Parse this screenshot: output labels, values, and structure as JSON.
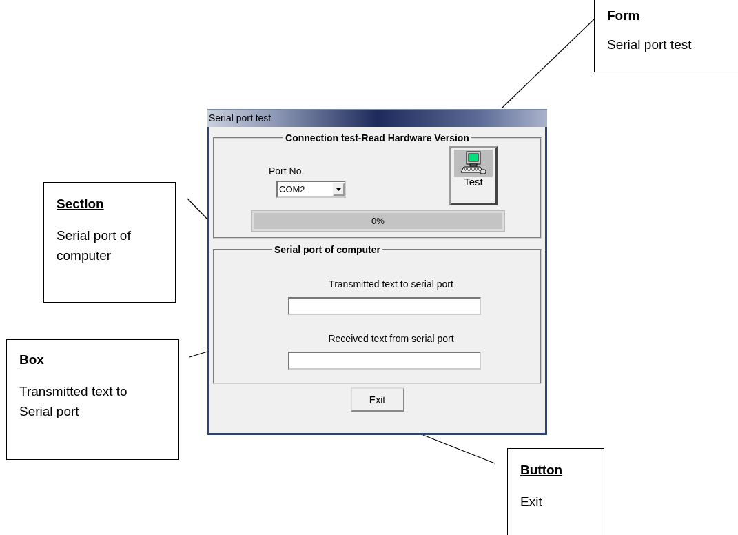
{
  "window": {
    "title": "Serial port test",
    "connection_group": {
      "title": "Connection test-Read Hardware Version",
      "port_label": "Port No.",
      "port_value": "COM2",
      "test_button": "Test",
      "progress": {
        "level": 0,
        "reading": "0%"
      }
    },
    "serial_group": {
      "title": "Serial port of computer",
      "transmitted_label": "Transmitted text to serial port",
      "received_label": "Received text from serial port"
    },
    "exit_button": "Exit"
  },
  "callouts": [
    {
      "heading": "Form",
      "text": "Serial port test"
    },
    {
      "heading": "Section",
      "text": "Serial port of computer"
    },
    {
      "heading": "Box",
      "text": "Transmitted text to Serial port"
    },
    {
      "heading": "Button",
      "text": "Exit"
    }
  ]
}
